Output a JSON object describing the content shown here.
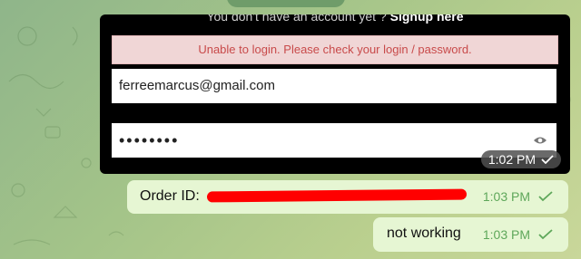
{
  "screenshot": {
    "top_text_prefix": "You don't have an account yet ?",
    "top_text_link": "Signup here",
    "error_message": "Unable to login. Please check your login / password.",
    "email_value": "ferreemarcus@gmail.com",
    "password_value": "••••••••",
    "timestamp": "1:02 PM"
  },
  "messages": [
    {
      "label": "Order ID:",
      "timestamp": "1:03 PM"
    },
    {
      "label": "not working",
      "timestamp": "1:03 PM"
    }
  ],
  "colors": {
    "bubble_bg": "#e6f6d3",
    "time_text": "#5ea75a",
    "error_text": "#c84a4a",
    "redaction": "#ff0000"
  },
  "icons": [
    "eye-icon",
    "check-icon",
    "double-check-icon"
  ]
}
